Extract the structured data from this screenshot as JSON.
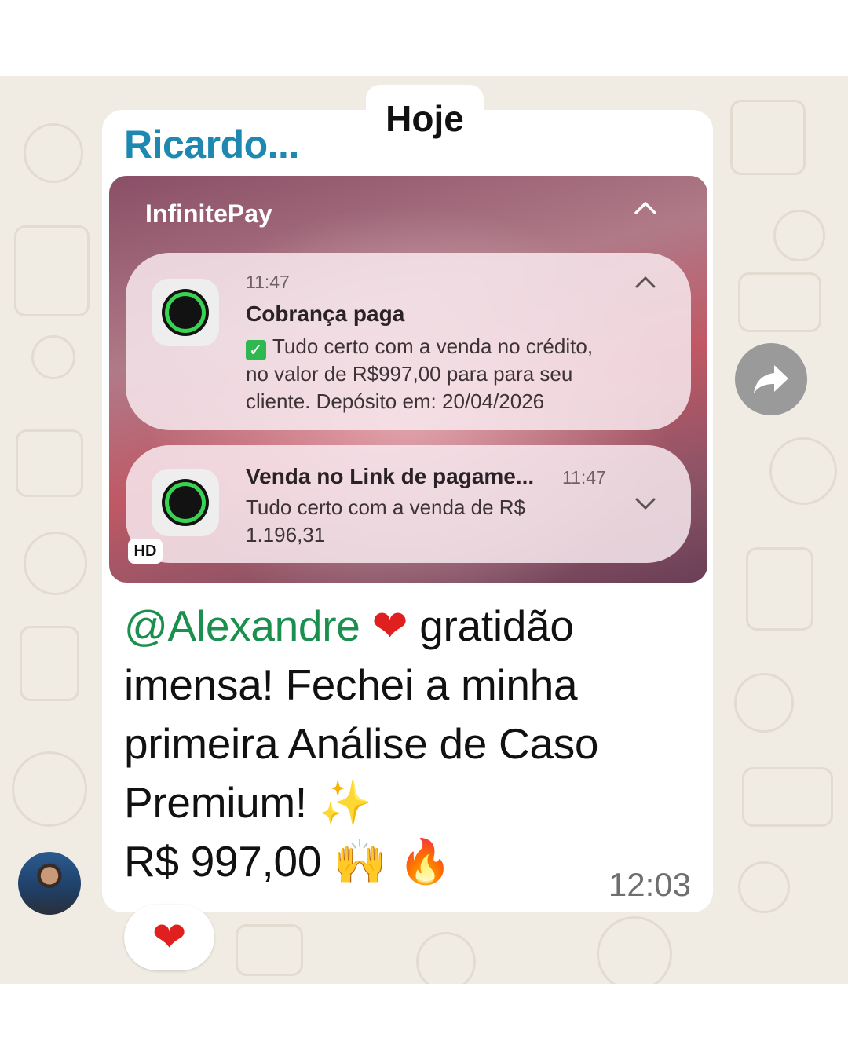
{
  "date_badge": "Hoje",
  "message": {
    "sender": "Ricardo...",
    "screenshot": {
      "app_name": "InfinitePay",
      "hd_badge": "HD",
      "notifications": [
        {
          "time": "11:47",
          "title": "Cobrança paga",
          "body_lines": [
            "Tudo certo com a venda no crédito,",
            "no valor de R$997,00 para para seu",
            "cliente. Depósito em: 20/04/2026"
          ],
          "check_icon": "check-box-emoji"
        },
        {
          "time": "11:47",
          "title": "Venda no Link de pagame...",
          "body_lines": [
            "Tudo certo com a venda de R$",
            "1.196,31"
          ]
        }
      ]
    },
    "text": {
      "mention": "@Alexandre",
      "heart_emoji": "❤",
      "line1_rest": "gratidão",
      "line2": "imensa! Fechei a minha",
      "line3": "primeira Análise de Caso",
      "line4": "Premium!",
      "sparkles_emoji": "✨",
      "line5": "R$ 997,00",
      "hands_emoji": "🙌",
      "fire_emoji": "🔥"
    },
    "timestamp": "12:03",
    "reaction": "❤"
  },
  "icons": {
    "forward": "forward-arrow-icon",
    "chevron_up": "chevron-up-icon",
    "chevron_down": "chevron-down-icon"
  },
  "colors": {
    "sender": "#1e88b0",
    "mention": "#1b8f4d",
    "chat_background": "#f0ebe3",
    "heart": "#e0201f"
  }
}
